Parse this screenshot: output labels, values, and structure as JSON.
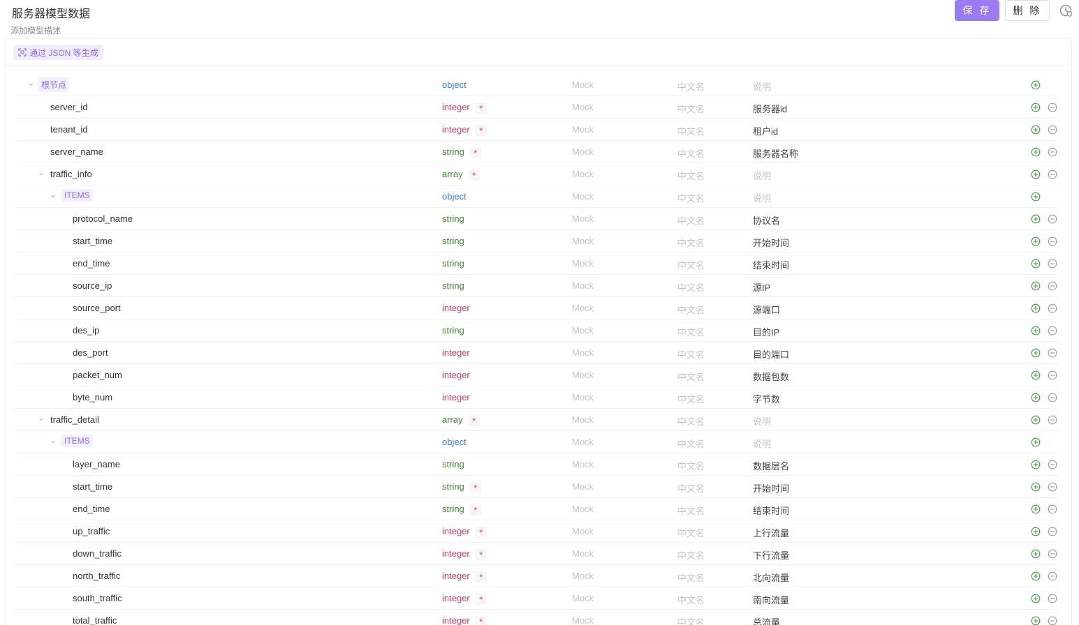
{
  "header": {
    "title": "服务器模型数据",
    "description": "添加模型描述",
    "save_label": "保 存",
    "delete_label": "删 除"
  },
  "toolbar": {
    "json_generate_label": "通过 JSON 等生成"
  },
  "columns": {
    "mock_placeholder": "Mock",
    "cn_placeholder": "中文名",
    "note_placeholder": "说明"
  },
  "colors": {
    "accent": "#9b7bf0",
    "object": "#2f7df0",
    "integer": "#e0356b",
    "string": "#3d8c2e",
    "add": "#3d9b3d"
  },
  "icons": {
    "add": "plus-circle-icon",
    "remove": "minus-circle-icon",
    "caret": "caret-down-icon",
    "history": "history-icon",
    "scan": "scan-icon"
  },
  "rows": [
    {
      "name": "根节点",
      "kind": "tag",
      "depth": 0,
      "caret": true,
      "type": "object",
      "required": false,
      "note": "",
      "removable": false
    },
    {
      "name": "server_id",
      "kind": "field",
      "depth": 1,
      "caret": false,
      "type": "integer",
      "required": true,
      "note": "服务器id",
      "removable": true
    },
    {
      "name": "tenant_id",
      "kind": "field",
      "depth": 1,
      "caret": false,
      "type": "integer",
      "required": true,
      "note": "租户id",
      "removable": true
    },
    {
      "name": "server_name",
      "kind": "field",
      "depth": 1,
      "caret": false,
      "type": "string",
      "required": true,
      "note": "服务器名称",
      "removable": true
    },
    {
      "name": "traffic_info",
      "kind": "field",
      "depth": 1,
      "caret": true,
      "type": "array",
      "required": true,
      "note": "",
      "removable": true
    },
    {
      "name": "ITEMS",
      "kind": "tag",
      "depth": 2,
      "caret": true,
      "type": "object",
      "required": false,
      "note": "",
      "removable": false
    },
    {
      "name": "protocol_name",
      "kind": "field",
      "depth": 3,
      "caret": false,
      "type": "string",
      "required": false,
      "note": "协议名",
      "removable": true
    },
    {
      "name": "start_time",
      "kind": "field",
      "depth": 3,
      "caret": false,
      "type": "string",
      "required": false,
      "note": "开始时间",
      "removable": true
    },
    {
      "name": "end_time",
      "kind": "field",
      "depth": 3,
      "caret": false,
      "type": "string",
      "required": false,
      "note": "结束时间",
      "removable": true
    },
    {
      "name": "source_ip",
      "kind": "field",
      "depth": 3,
      "caret": false,
      "type": "string",
      "required": false,
      "note": "源IP",
      "removable": true
    },
    {
      "name": "source_port",
      "kind": "field",
      "depth": 3,
      "caret": false,
      "type": "integer",
      "required": false,
      "note": "源端口",
      "removable": true
    },
    {
      "name": "des_ip",
      "kind": "field",
      "depth": 3,
      "caret": false,
      "type": "string",
      "required": false,
      "note": "目的IP",
      "removable": true
    },
    {
      "name": "des_port",
      "kind": "field",
      "depth": 3,
      "caret": false,
      "type": "integer",
      "required": false,
      "note": "目的端口",
      "removable": true
    },
    {
      "name": "packet_num",
      "kind": "field",
      "depth": 3,
      "caret": false,
      "type": "integer",
      "required": false,
      "note": "数据包数",
      "removable": true
    },
    {
      "name": "byte_num",
      "kind": "field",
      "depth": 3,
      "caret": false,
      "type": "integer",
      "required": false,
      "note": "字节数",
      "removable": true
    },
    {
      "name": "traffic_detail",
      "kind": "field",
      "depth": 1,
      "caret": true,
      "type": "array",
      "required": true,
      "note": "",
      "removable": true
    },
    {
      "name": "ITEMS",
      "kind": "tag",
      "depth": 2,
      "caret": true,
      "type": "object",
      "required": false,
      "note": "",
      "removable": false
    },
    {
      "name": "layer_name",
      "kind": "field",
      "depth": 3,
      "caret": false,
      "type": "string",
      "required": false,
      "note": "数据层名",
      "removable": true
    },
    {
      "name": "start_time",
      "kind": "field",
      "depth": 3,
      "caret": false,
      "type": "string",
      "required": true,
      "note": "开始时间",
      "removable": true
    },
    {
      "name": "end_time",
      "kind": "field",
      "depth": 3,
      "caret": false,
      "type": "string",
      "required": true,
      "note": "结束时间",
      "removable": true
    },
    {
      "name": "up_traffic",
      "kind": "field",
      "depth": 3,
      "caret": false,
      "type": "integer",
      "required": true,
      "note": "上行流量",
      "removable": true
    },
    {
      "name": "down_traffic",
      "kind": "field",
      "depth": 3,
      "caret": false,
      "type": "integer",
      "required": true,
      "note": "下行流量",
      "removable": true
    },
    {
      "name": "north_traffic",
      "kind": "field",
      "depth": 3,
      "caret": false,
      "type": "integer",
      "required": true,
      "note": "北向流量",
      "removable": true
    },
    {
      "name": "south_traffic",
      "kind": "field",
      "depth": 3,
      "caret": false,
      "type": "integer",
      "required": true,
      "note": "南向流量",
      "removable": true
    },
    {
      "name": "total_traffic",
      "kind": "field",
      "depth": 3,
      "caret": false,
      "type": "integer",
      "required": true,
      "note": "总流量",
      "removable": true
    }
  ]
}
